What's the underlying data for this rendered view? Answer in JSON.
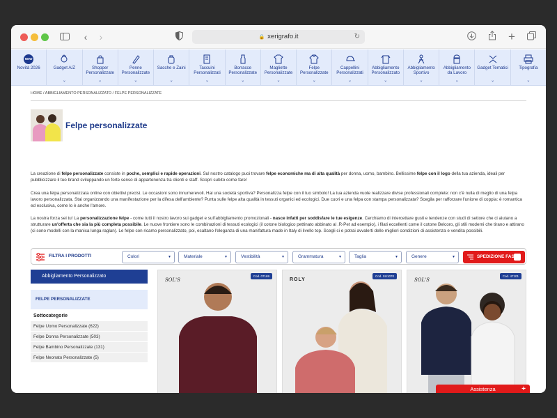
{
  "browser": {
    "url": "xerigrafo.it"
  },
  "nav": [
    {
      "label": "Novità 2026",
      "icon": "new-badge-icon",
      "badge": "NEW",
      "chevron": false
    },
    {
      "label": "Gadget A/Z",
      "icon": "gadget-icon",
      "chevron": true
    },
    {
      "label": "Shopper Personalizzate",
      "icon": "shopper-icon",
      "chevron": true
    },
    {
      "label": "Penne Personalizzate",
      "icon": "pen-icon",
      "chevron": true
    },
    {
      "label": "Sacche e Zaini",
      "icon": "backpack-icon",
      "chevron": true
    },
    {
      "label": "Taccuini Personalizzati",
      "icon": "notebook-icon",
      "chevron": true
    },
    {
      "label": "Borracce Personalizzate",
      "icon": "bottle-icon",
      "chevron": true
    },
    {
      "label": "Magliette Personalizzate",
      "icon": "tshirt-icon",
      "chevron": true
    },
    {
      "label": "Felpe Personalizzate",
      "icon": "hoodie-icon",
      "chevron": true
    },
    {
      "label": "Cappellini Personalizzati",
      "icon": "cap-icon",
      "chevron": true
    },
    {
      "label": "Abbigliamento Personalizzato",
      "icon": "apparel-icon",
      "chevron": true
    },
    {
      "label": "Abbigliamento Sportivo",
      "icon": "sport-icon",
      "chevron": true
    },
    {
      "label": "Abbigliamento da Lavoro",
      "icon": "workwear-icon",
      "chevron": true
    },
    {
      "label": "Gadget Tematici",
      "icon": "themed-icon",
      "chevron": true
    },
    {
      "label": "Tipografia",
      "icon": "print-icon",
      "chevron": true
    }
  ],
  "breadcrumb": "HOME / ABBIGLIAMENTO PERSONALIZZATO / FELPE PERSONALIZZATE",
  "page_title": "Felpe personalizzate",
  "intro": {
    "p1": [
      {
        "t": "La creazione di ",
        "b": false
      },
      {
        "t": "felpe personalizzate",
        "b": true
      },
      {
        "t": " consiste in ",
        "b": false
      },
      {
        "t": "poche, semplici e rapide operazioni",
        "b": true
      },
      {
        "t": ". Sul nostro catalogo puoi trovare ",
        "b": false
      },
      {
        "t": "felpe economiche ma di alta qualità",
        "b": true
      },
      {
        "t": " per donna, uomo, bambino. Bellissime ",
        "b": false
      },
      {
        "t": "felpe con il logo",
        "b": true
      },
      {
        "t": " della tua azienda, ideali per pubblicizzare il tuo brand sviluppando un forte senso di appartenenza tra clienti e staff. Scopri subito come fare!",
        "b": false
      }
    ],
    "p2": [
      {
        "t": "Crea una felpa personalizzata online con obiettivi precisi. Le occasioni sono innumerevoli. Hai una società sportiva? Personalizza felpe con il tuo simbolo! La tua azienda vuole realizzare divise professionali complete: non c'è nulla di meglio di una felpa lavoro personalizzata. Stai organizzando una manifestazione per la difesa dell'ambiente? Punta sulle felpe alta qualità in tessuti organici ed ecologici. Due cuori e una felpa con stampa personalizzata? Scegila per rafforzare l'unione di coppia: è romantica ed esclusiva, come lo è anche l'amore.",
        "b": false
      }
    ],
    "p3": [
      {
        "t": "La nostra forza sei tu! La ",
        "b": false
      },
      {
        "t": "personalizzazione felpe",
        "b": true
      },
      {
        "t": " - come tutti il nostro lavoro sui gadget e sull'abbigliamento promozionali - ",
        "b": false
      },
      {
        "t": "nasce infatti per soddisfare le tue esigenze",
        "b": true
      },
      {
        "t": ". Cerchiamo di intercettare gusti e tendenze con studi di settore che ci aiutano a strutturare ",
        "b": false
      },
      {
        "t": "un'offerta che sia la più completa possibile",
        "b": true
      },
      {
        "t": ". Le nuove frontiere sono le combinazioni di tessuti ecologici (il cotone biologico pettinato abbinato al .R-Pet ad esempio), i filati eccellenti come il cotone Belcoro, gli stili moderni che tirano e attirano (ci sono modelli con la manica lunga raglan). Le felpe con ricamo personalizzato, poi, esaltano l'eleganza di una manifattura made in Italy di livello top. Scegli ci e potrai avvalerti delle migliori condizioni di assistenza e vendita possibili.",
        "b": false
      }
    ]
  },
  "filter": {
    "label": "FILTRA I PRODOTTI",
    "selects": [
      "Colori",
      "Materiale",
      "Vestibilità",
      "Grammatura",
      "Taglia",
      "Genere"
    ],
    "shipping_label": "SPEDIZIONE FAST"
  },
  "sidebar": {
    "header": "Abbigliamento Personalizzato",
    "current": "FELPE PERSONALIZZATE",
    "subcat_title": "Sottocategorie",
    "items": [
      "Felpe Uomo Personalizzate (622)",
      "Felpe Donna Personalizzate (503)",
      "Felpe Bambino Personalizzate (131)",
      "Felpe Neonato Personalizzate (5)"
    ]
  },
  "products": [
    {
      "code": "Cod. 07169",
      "brand": "SOL'S",
      "shirt": "#5a1c27",
      "skin": "#b07a57"
    },
    {
      "code": "Cod. SU1070",
      "brand": "ROLY",
      "shirt": "#ece7dc",
      "skin": "#c99478"
    },
    {
      "code": "Cod. 47101",
      "brand": "SOL'S",
      "shirt": "#1d2440",
      "skin": "#7a4a2f"
    }
  ],
  "assist_label": "Assistenza",
  "colors": {
    "brand_blue": "#1f3f94",
    "accent_red": "#e11a1a",
    "nav_bg": "#e3ebfb"
  }
}
